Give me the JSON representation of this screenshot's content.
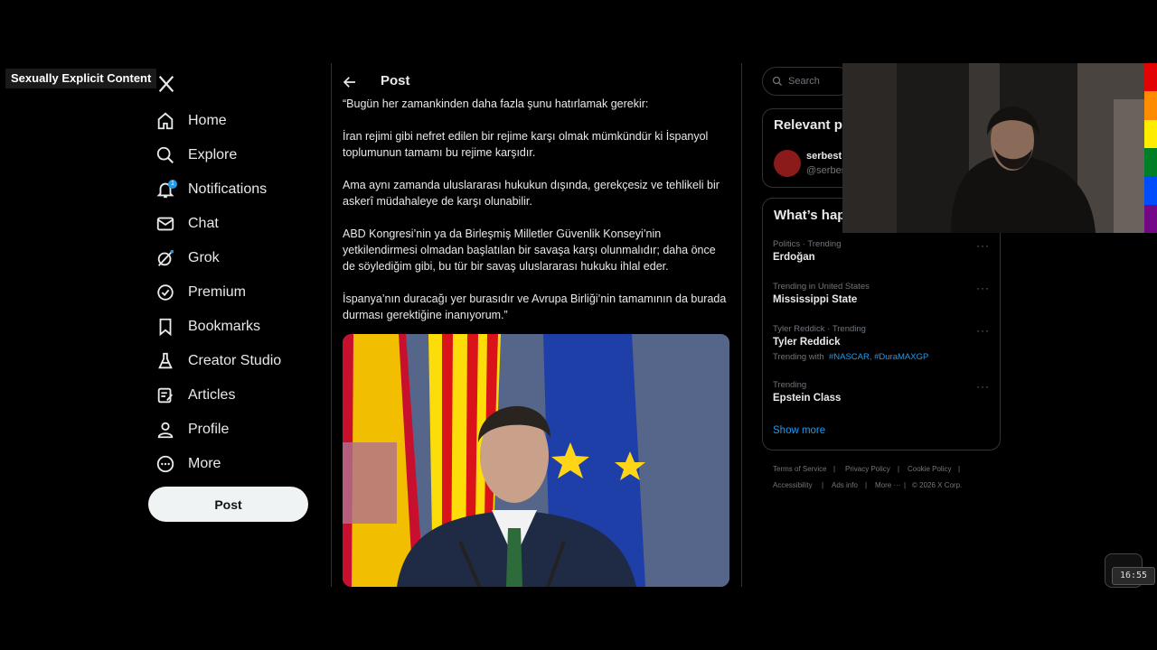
{
  "overlay": {
    "label": "Sexually Explicit Content"
  },
  "nav": {
    "items": [
      {
        "label": "Home",
        "icon": "home-icon"
      },
      {
        "label": "Explore",
        "icon": "search-icon"
      },
      {
        "label": "Notifications",
        "icon": "bell-icon",
        "badge": "1"
      },
      {
        "label": "Chat",
        "icon": "mail-icon"
      },
      {
        "label": "Grok",
        "icon": "grok-icon"
      },
      {
        "label": "Premium",
        "icon": "verified-icon"
      },
      {
        "label": "Bookmarks",
        "icon": "bookmark-icon"
      },
      {
        "label": "Creator Studio",
        "icon": "flask-icon"
      },
      {
        "label": "Articles",
        "icon": "article-icon"
      },
      {
        "label": "Profile",
        "icon": "person-icon"
      },
      {
        "label": "More",
        "icon": "more-circle-icon"
      }
    ],
    "post_button": "Post"
  },
  "main": {
    "header": "Post",
    "paragraphs": [
      "“Bugün her zamankinden daha fazla şunu hatırlamak gerekir:",
      "İran rejimi gibi nefret edilen bir rejime karşı olmak mümkündür ki İspanyol toplumunun tamamı bu rejime karşıdır.",
      "Ama aynı zamanda uluslararası hukukun dışında, gerekçesiz ve tehlikeli bir askerî müdahaleye de karşı olunabilir.",
      "ABD Kongresi’nin ya da Birleşmiş Milletler Güvenlik Konseyi’nin yetkilendirmesi olmadan başlatılan bir savaşa karşı olunmalıdır; daha önce de söylediğim gibi, bu tür bir savaş uluslararası hukuku ihlal eder.",
      "İspanya’nın duracağı yer burasıdır ve Avrupa Birliği’nin tamamının da burada durması gerektiğine inanıyorum.”"
    ]
  },
  "right": {
    "search_placeholder": "Search",
    "relevant": {
      "title": "Relevant p",
      "name": "serbest",
      "handle": "@serbes"
    },
    "trends": {
      "title": "What’s hap",
      "items": [
        {
          "context": "Politics · Trending",
          "name": "Erdoğan"
        },
        {
          "context": "Trending in United States",
          "name": "Mississippi State"
        },
        {
          "context": "Tyler Reddick · Trending",
          "name": "Tyler Reddick",
          "with_label": "Trending with",
          "tags": [
            "#NASCAR",
            "#DuraMAXGP"
          ]
        },
        {
          "context": "Trending",
          "name": "Epstein Class"
        }
      ],
      "more_glyph": "···",
      "show_more": "Show more"
    },
    "footer": {
      "links": [
        "Terms of Service",
        "Privacy Policy",
        "Cookie Policy",
        "Accessibility",
        "Ads info",
        "More ···",
        "© 2026 X Corp."
      ],
      "separator": "|"
    }
  },
  "clock": "16:55",
  "colors": {
    "accent": "#1d9bf0",
    "background": "#000000",
    "border": "#2f3336",
    "muted": "#71767b",
    "text": "#e7e9ea"
  },
  "rainbow": [
    "#e40303",
    "#ff8c00",
    "#ffed00",
    "#008026",
    "#004dff",
    "#750787"
  ]
}
